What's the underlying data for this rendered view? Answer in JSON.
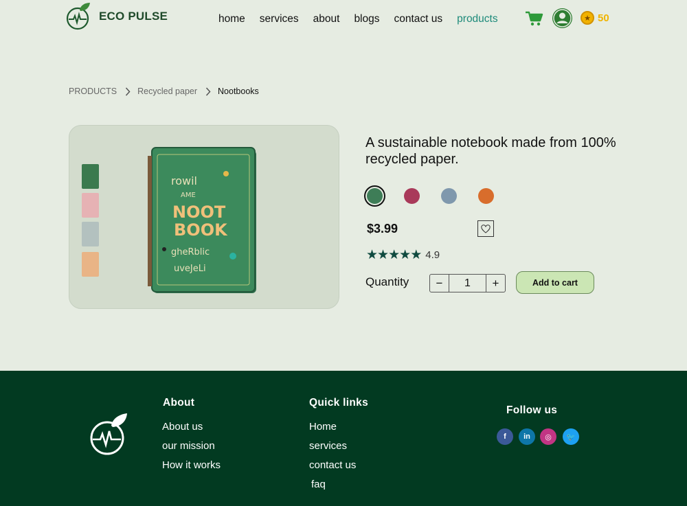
{
  "header": {
    "brand": "ECO PULSE",
    "nav": [
      {
        "label": "home"
      },
      {
        "label": "services"
      },
      {
        "label": "about"
      },
      {
        "label": "blogs"
      },
      {
        "label": "contact us"
      },
      {
        "label": "products",
        "active": true
      }
    ],
    "coins": "50"
  },
  "breadcrumb": [
    "PRODUCTS",
    "Recycled paper",
    "Nootbooks"
  ],
  "product": {
    "title": "A sustainable notebook made from 100% recycled paper.",
    "colors": [
      "#3e7d57",
      "#a93a5a",
      "#7f98ad",
      "#d86d2c"
    ],
    "selected_color": "#3e7d57",
    "price": "$3.99",
    "rating": "4.9",
    "stars": 5,
    "quantity_label": "Quantity",
    "quantity": "1",
    "minus_label": "−",
    "plus_label": "+",
    "add_to_cart": "Add to cart",
    "thumbnail_colors": [
      "#3b7a4e",
      "#e6b2b4",
      "#b3c1bf",
      "#e9b486"
    ],
    "notebook_cover_text": [
      "rowil",
      "AME",
      "NOOT",
      "BOOK",
      "gheRblic",
      "uveJeLi"
    ]
  },
  "footer": {
    "about": {
      "heading": "About",
      "links": [
        "About us",
        "our mission",
        "How it works"
      ]
    },
    "quick_links": {
      "heading": "Quick links",
      "links": [
        "Home",
        "services",
        "contact us",
        "faq"
      ]
    },
    "follow": {
      "heading": "Follow us",
      "social": [
        {
          "name": "facebook",
          "glyph": "f",
          "color": "#3b5998"
        },
        {
          "name": "linkedin",
          "glyph": "in",
          "color": "#0e76a8"
        },
        {
          "name": "instagram",
          "glyph": "◎",
          "color": "#c13584"
        },
        {
          "name": "twitter",
          "glyph": "🐦",
          "color": "#1da1f2"
        }
      ]
    }
  }
}
